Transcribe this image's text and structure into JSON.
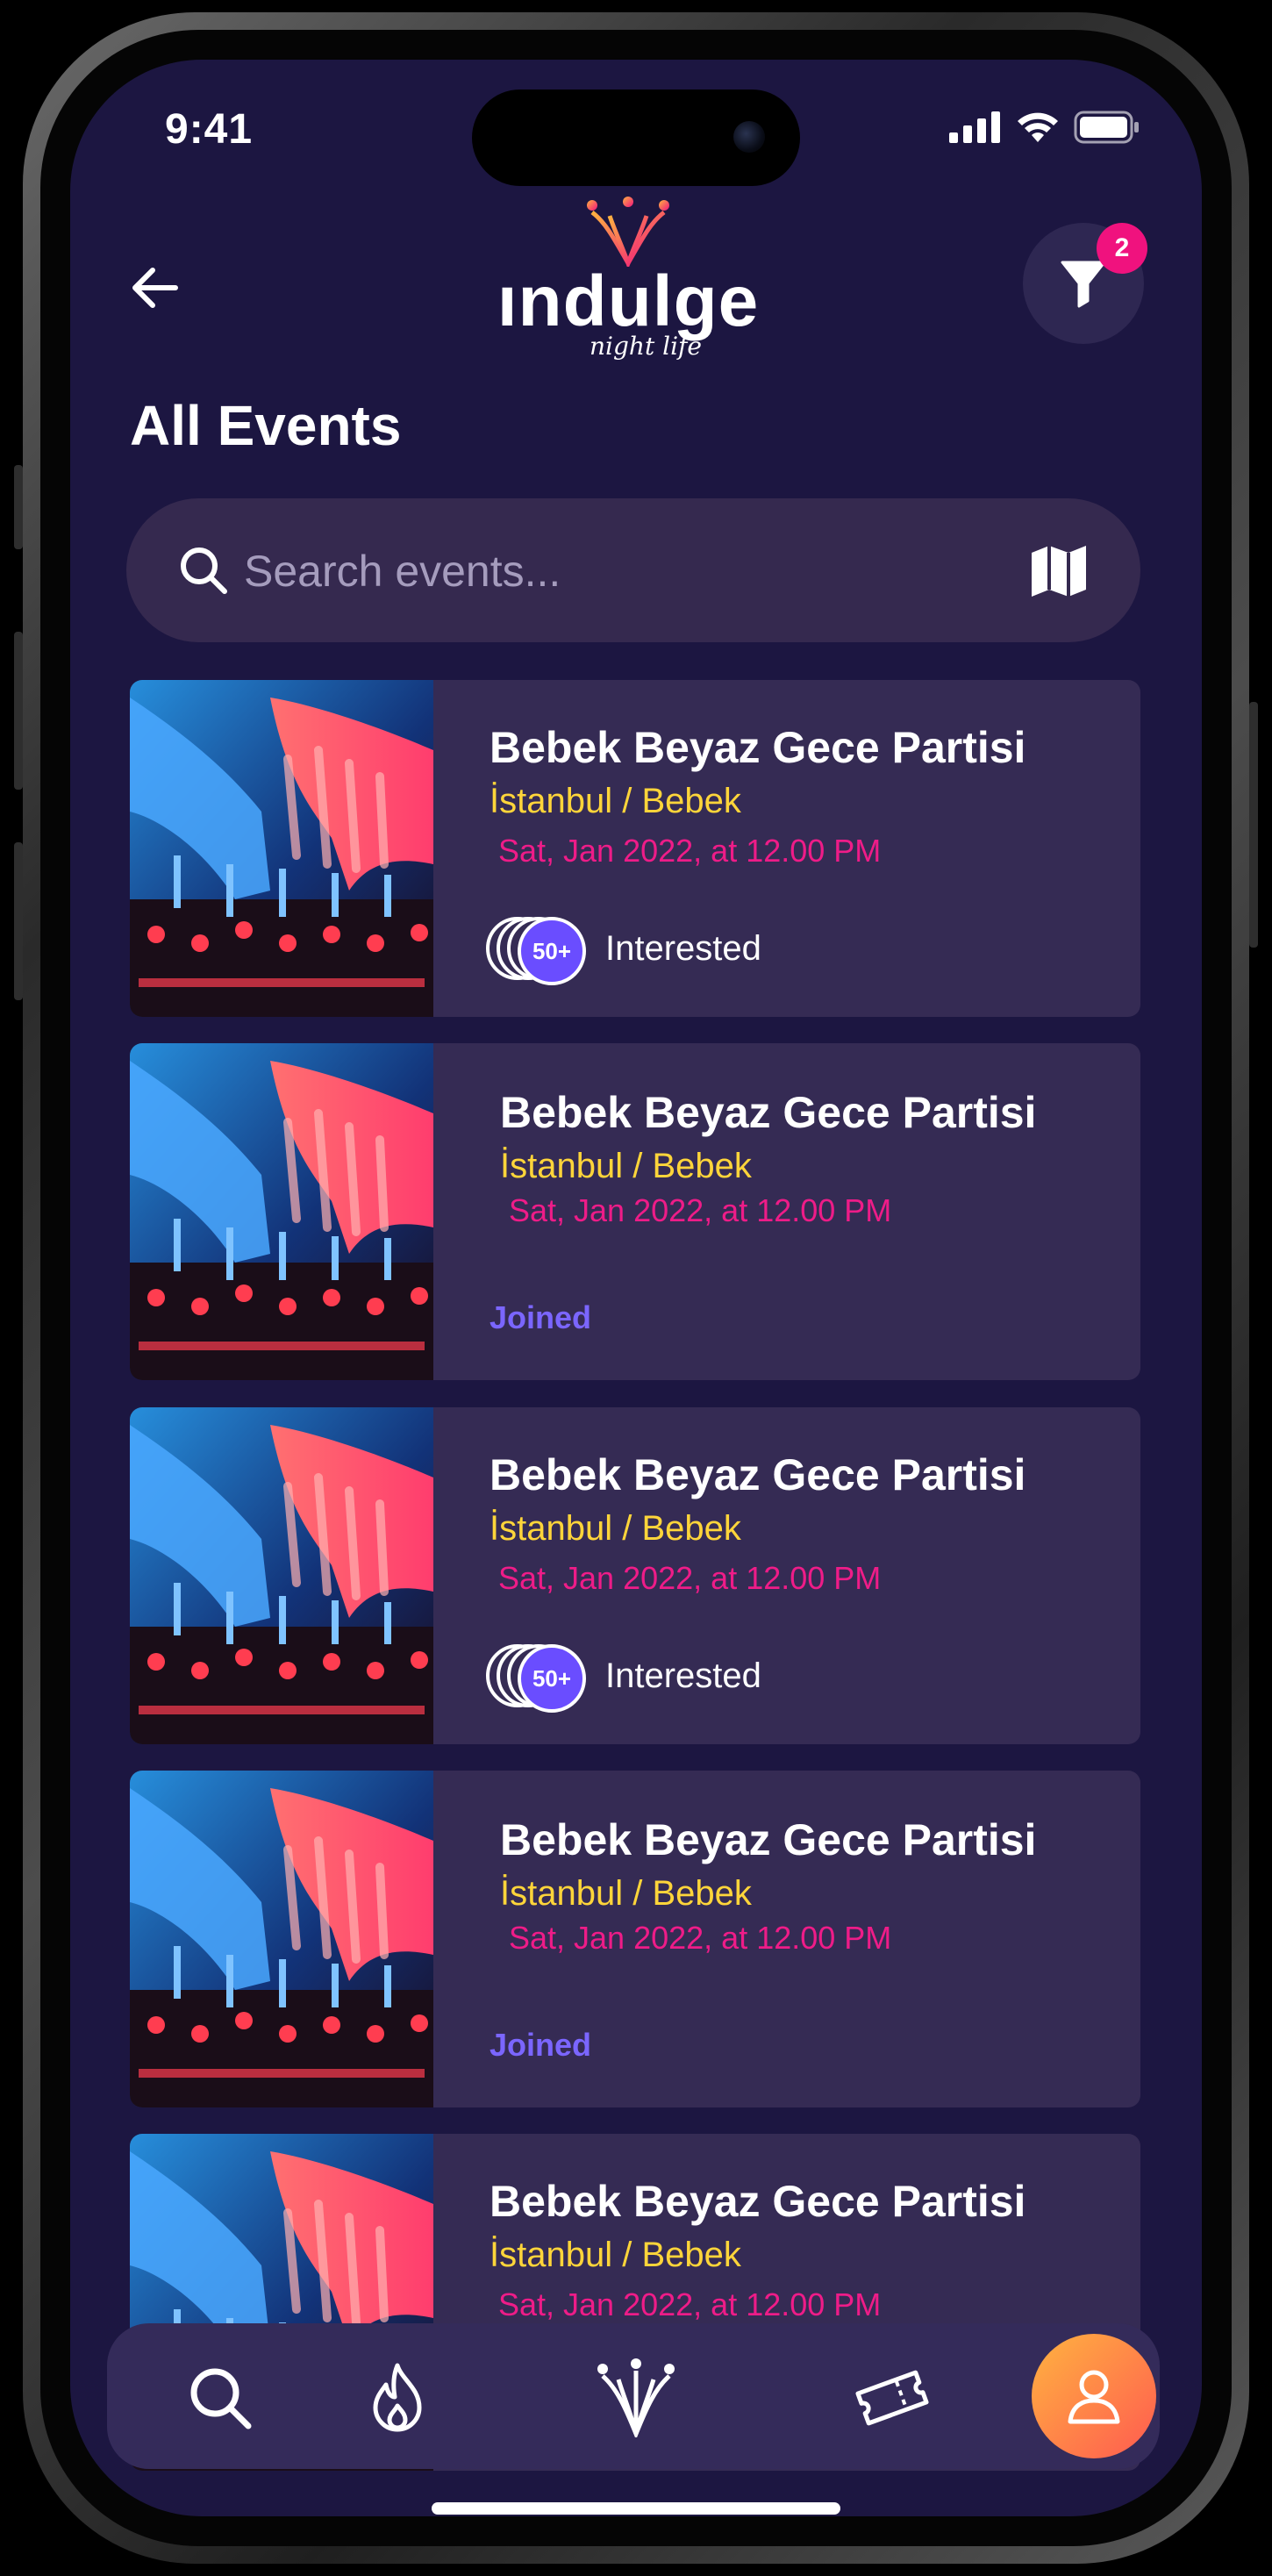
{
  "status_bar": {
    "time": "9:41"
  },
  "header": {
    "logo_word": "ındulge",
    "logo_sub": "night life",
    "filter_badge_count": "2",
    "page_title": "All Events"
  },
  "search": {
    "placeholder": "Search events..."
  },
  "events": [
    {
      "title": "Bebek Beyaz Gece Partisi",
      "location": "İstanbul / Bebek",
      "date": "Sat, Jan 2022, at 12.00 PM",
      "status": "interested",
      "count": "50+",
      "interest_label": "Interested"
    },
    {
      "title": "Bebek Beyaz Gece Partisi",
      "location": "İstanbul / Bebek",
      "date": "Sat, Jan 2022, at 12.00 PM",
      "status": "joined",
      "joined_label": "Joined"
    },
    {
      "title": "Bebek Beyaz Gece Partisi",
      "location": "İstanbul / Bebek",
      "date": "Sat, Jan 2022, at 12.00 PM",
      "status": "interested",
      "count": "50+",
      "interest_label": "Interested"
    },
    {
      "title": "Bebek Beyaz Gece Partisi",
      "location": "İstanbul / Bebek",
      "date": "Sat, Jan 2022, at 12.00 PM",
      "status": "joined",
      "joined_label": "Joined"
    },
    {
      "title": "Bebek Beyaz Gece Partisi",
      "location": "İstanbul / Bebek",
      "date": "Sat, Jan 2022, at 12.00 PM",
      "status": "partial"
    }
  ],
  "nav": {
    "items": [
      "search-icon",
      "flame-icon",
      "indulge-crown-icon",
      "ticket-icon",
      "profile-icon"
    ],
    "active": "profile-icon"
  },
  "colors": {
    "background": "#1c1641",
    "card": "#352b54",
    "title": "#ffffff",
    "location": "#ffd53a",
    "date": "#ee1c88",
    "joined": "#7b66ff",
    "badge": "#f0127e",
    "profile_gradient_start": "#ffb340",
    "profile_gradient_end": "#ff5a50"
  }
}
